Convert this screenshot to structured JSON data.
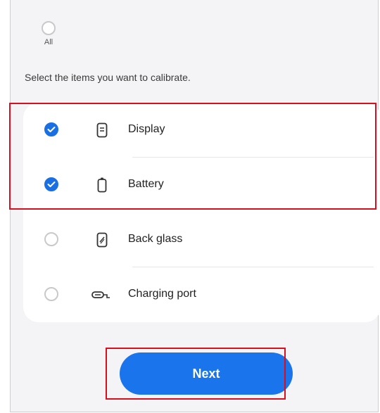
{
  "all_option": {
    "label": "All",
    "checked": false
  },
  "instruction": "Select the items you want to calibrate.",
  "items": [
    {
      "label": "Display",
      "checked": true,
      "icon": "phone-display-icon"
    },
    {
      "label": "Battery",
      "checked": true,
      "icon": "battery-icon"
    },
    {
      "label": "Back glass",
      "checked": false,
      "icon": "back-glass-icon"
    },
    {
      "label": "Charging port",
      "checked": false,
      "icon": "charging-port-icon"
    }
  ],
  "next_button": {
    "label": "Next"
  },
  "colors": {
    "accent": "#1a75ec",
    "checked": "#1a6fe3",
    "highlight": "#d90f1f",
    "background": "#f4f4f6"
  }
}
